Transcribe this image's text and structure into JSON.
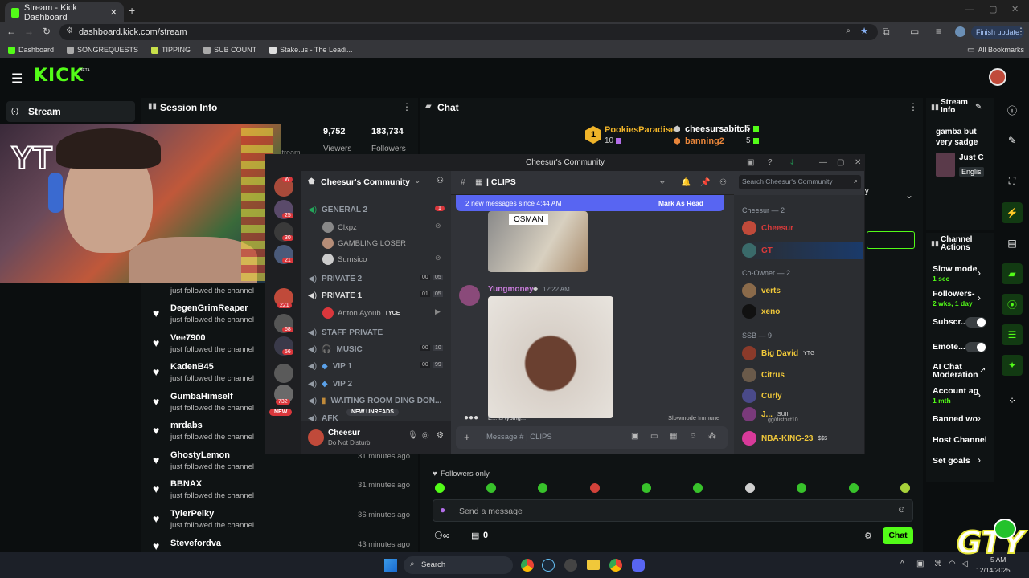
{
  "browser": {
    "tab_title": "Stream - Kick Dashboard",
    "url": "dashboard.kick.com/stream",
    "finish_update": "Finish update",
    "bookmarks": [
      "Dashboard",
      "SONGREQUESTS",
      "TIPPING",
      "SUB COUNT",
      "Stake.us - The Leadi..."
    ],
    "all_bookmarks": "All Bookmarks"
  },
  "kick": {
    "logo": "KICK",
    "beta": "BETA",
    "accent": "#53fc18"
  },
  "nav": {
    "stream_label": "Stream"
  },
  "session": {
    "title": "Session Info",
    "viewers_value": "9,752",
    "viewers_label": "Viewers",
    "followers_value": "183,734",
    "followers_label": "Followers",
    "stream_label": "stream"
  },
  "follows": [
    {
      "name": "",
      "sub": "just followed the channel",
      "time": ""
    },
    {
      "name": "DegenGrimReaper",
      "sub": "just followed the channel",
      "time": ""
    },
    {
      "name": "Vee7900",
      "sub": "just followed the channel",
      "time": ""
    },
    {
      "name": "KadenB45",
      "sub": "just followed the channel",
      "time": ""
    },
    {
      "name": "GumbaHimself",
      "sub": "just followed the channel",
      "time": ""
    },
    {
      "name": "mrdabs",
      "sub": "just followed the channel",
      "time": ""
    },
    {
      "name": "GhostyLemon",
      "sub": "just followed the channel",
      "time": "31 minutes ago"
    },
    {
      "name": "BBNAX",
      "sub": "just followed the channel",
      "time": "31 minutes ago"
    },
    {
      "name": "TylerPelky",
      "sub": "just followed the channel",
      "time": "36 minutes ago"
    },
    {
      "name": "Stevefordva",
      "sub": "",
      "time": "43 minutes ago"
    }
  ],
  "chat": {
    "title": "Chat",
    "leader1": "PookiesParadise",
    "leader1_count": "10",
    "leader2": "cheesursabitch",
    "leader2_count": "5",
    "leader3": "banning2",
    "leader3_count": "5",
    "rank_badge": "1",
    "followers_only": "Followers only",
    "send_placeholder": "Send a message",
    "count": "0",
    "chat_button": "Chat"
  },
  "stream_info": {
    "title": "Stream Info",
    "stream_title": "gamba but very sadge",
    "category": "Just C",
    "language": "Englis"
  },
  "channel_actions": {
    "title": "Channel Actions",
    "items": [
      {
        "label": "Slow mode",
        "sub": "1 sec"
      },
      {
        "label": "Followers-",
        "sub": "2 wks, 1 day"
      },
      {
        "label": "Subscr...",
        "sub": ""
      },
      {
        "label": "Emote...",
        "sub": ""
      },
      {
        "label": "AI Chat Moderation",
        "sub": ""
      },
      {
        "label": "Account ag",
        "sub": "1 mth"
      },
      {
        "label": "Banned wo",
        "sub": ""
      },
      {
        "label": "Host Channel",
        "sub": ""
      },
      {
        "label": "Set goals",
        "sub": ""
      }
    ]
  },
  "discord": {
    "window_title": "Cheesur's Community",
    "server_name": "Cheesur's Community",
    "channel_header": "| CLIPS",
    "search_placeholder": "Search Cheesur's Community",
    "new_messages": "2 new messages since 4:44 AM",
    "mark_as_read": "Mark As Read",
    "image_caption": "OSMAN",
    "message_author": "Yungmoney",
    "message_time": "12:22 AM",
    "typing": "E... is typing...",
    "slowmode": "Slowmode Immune",
    "compose_placeholder": "Message # | CLIPS",
    "guild_badges": [
      "W",
      "25",
      "30",
      "21",
      "221",
      "68",
      "56",
      "732"
    ],
    "new_label": "NEW",
    "channels": {
      "general2": "GENERAL 2",
      "general2_badge": "1",
      "users_general": [
        "Clxpz",
        "GAMBLING LOSER",
        "Sumsico"
      ],
      "private2": "PRIVATE 2",
      "private2_counts": [
        "00",
        "05"
      ],
      "private1": "PRIVATE 1",
      "private1_counts": [
        "01",
        "05"
      ],
      "private1_user": "Anton Ayoub",
      "private1_tag": "TYCE",
      "staff": "STAFF PRIVATE",
      "music": "MUSIC",
      "music_counts": [
        "00",
        "10"
      ],
      "vip1": "VIP 1",
      "vip1_counts": [
        "00",
        "99"
      ],
      "vip2": "VIP 2",
      "waiting": "WAITING ROOM DING DON...",
      "afk": "AFK",
      "new_unreads": "NEW UNREADS"
    },
    "user_panel": {
      "name": "Cheesur",
      "status": "Do Not Disturb"
    },
    "members": {
      "cat_owner": "Cheesur — 2",
      "owner1": "Cheesur",
      "owner2": "GT",
      "cat_coowner": "Co-Owner — 2",
      "coowner1": "verts",
      "coowner2": "xeno",
      "cat_ssb": "SSB — 9",
      "ssb": [
        "Big David",
        "Citrus",
        "Curly",
        "J...",
        "NBA-KING-23"
      ],
      "ssb_tags": [
        "YTG",
        "",
        "",
        "SUII",
        "$$$"
      ],
      "ssb_sub": ".gg/district10"
    }
  },
  "taskbar": {
    "search": "Search",
    "time": "5 AM",
    "date": "12/14/2025"
  },
  "overlay": {
    "webcam_text": "YT",
    "logo_text": "GTY"
  }
}
